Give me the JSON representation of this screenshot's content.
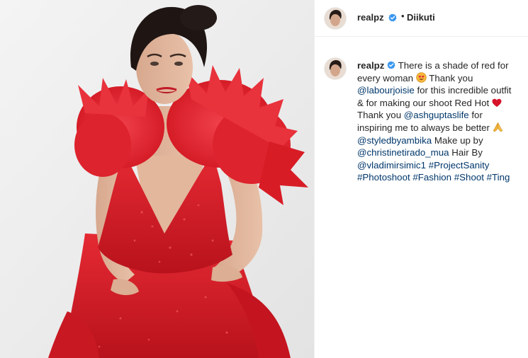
{
  "post": {
    "username": "realpz",
    "separator": "•",
    "follow_label": "Diikuti"
  },
  "caption": {
    "username": "realpz",
    "segments": {
      "s1": "There is a shade of red for",
      "s2": "every woman",
      "s3": "Thank you",
      "m1": "@labourjoisie",
      "s4": "for this incredible outfit",
      "s5": "& for making our shoot Red Hot",
      "s6": "Thank you",
      "m2": "@ashguptaslife",
      "s7": "for",
      "s8": "inspiring me to always be better",
      "m3": "@styledbyambika",
      "s9": "Make up by",
      "m4": "@christinetirado_mua",
      "s10": "Hair By",
      "m5": "@vladimirsimic1",
      "h1": "#ProjectSanity",
      "h2": "#Photoshoot",
      "h3": "#Fashion",
      "h4": "#Shoot",
      "h5": "#Ting"
    }
  },
  "icons": {
    "verified": "verified-badge-icon",
    "emoji_smile": "smiling-heart-eyes-emoji-icon",
    "emoji_heart": "red-heart-emoji-icon",
    "emoji_pray": "folded-hands-emoji-icon"
  },
  "colors": {
    "text": "#262626",
    "link": "#00376b",
    "verified": "#3897f0",
    "dress_red": "#d9202a",
    "divider": "#efefef"
  }
}
